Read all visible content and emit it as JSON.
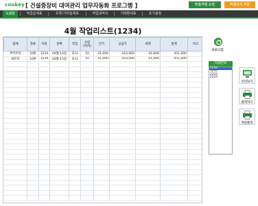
{
  "header": {
    "logo": "coukey",
    "title": "[ 건설중장비 대여관리 업무자동화 프로그램 ]",
    "btn_custom": "맞춤엑셀 요청",
    "btn_order": "엑셀서식 주문"
  },
  "tabs": [
    {
      "label": "도움말",
      "active": true
    },
    {
      "label": "작업집계표",
      "active": false
    },
    {
      "label": "유류/기타집계표",
      "active": false
    },
    {
      "label": "작업내역서",
      "active": false
    },
    {
      "label": "거래명세표",
      "active": false
    },
    {
      "label": "초기설정",
      "active": false
    }
  ],
  "page_title": "4월 작업리스트(1234)",
  "table": {
    "headers": [
      "업체",
      "종류",
      "차량",
      "날짜",
      "작업",
      "수량\n(회차)",
      "단가",
      "공급가",
      "세액",
      "합계",
      "비고"
    ],
    "rows": [
      [
        "쿠키트럭",
        "10톤",
        "1234",
        "04월 14일",
        "토사",
        "10",
        "41,000",
        "410,000",
        "41,000",
        "451,000",
        ""
      ],
      [
        "쿡트럭",
        "10톤",
        "1234",
        "04월 15일",
        "토사",
        "10",
        "41,000",
        "410,000",
        "41,000",
        "451,000",
        ""
      ]
    ]
  },
  "sidebar": {
    "refresh_label": "새로고침",
    "spec_header": "차량번호",
    "spec_items": [
      {
        "label": "1234",
        "selected": true
      },
      {
        "label": "1235",
        "selected": false
      },
      {
        "label": "2222",
        "selected": false
      },
      {
        "label": "2224",
        "selected": false
      }
    ],
    "preview_label": "미리보기",
    "print_label": "출력하기",
    "vehicle_print_label": "차량출력"
  },
  "colors": {
    "accent": "#2a9a3c",
    "orange": "#ef9c22",
    "tabbar": "#383838"
  }
}
